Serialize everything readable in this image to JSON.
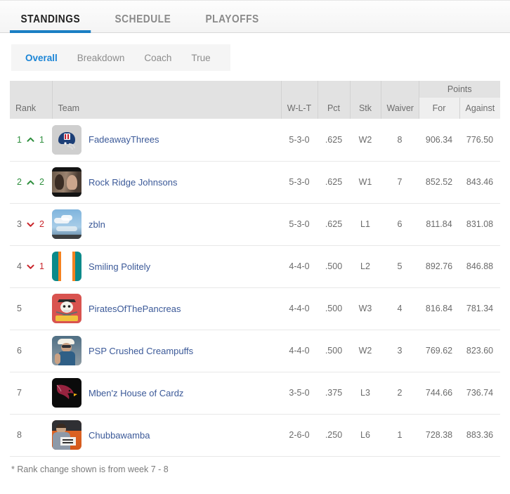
{
  "tabs": [
    {
      "label": "STANDINGS",
      "active": true
    },
    {
      "label": "SCHEDULE",
      "active": false
    },
    {
      "label": "PLAYOFFS",
      "active": false
    }
  ],
  "subtabs": [
    {
      "label": "Overall",
      "active": true
    },
    {
      "label": "Breakdown",
      "active": false
    },
    {
      "label": "Coach",
      "active": false
    },
    {
      "label": "True",
      "active": false
    }
  ],
  "table": {
    "group_header": "Points",
    "columns": {
      "rank": "Rank",
      "team": "Team",
      "wlt": "W-L-T",
      "pct": "Pct",
      "stk": "Stk",
      "waiver": "Waiver",
      "points_for": "For",
      "points_against": "Against"
    },
    "rows": [
      {
        "rank": "1",
        "change_dir": "up",
        "change": "1",
        "team": "FadeawayThrees",
        "avatar": "helmet",
        "wlt": "5-3-0",
        "pct": ".625",
        "stk": "W2",
        "waiver": "8",
        "pf": "906.34",
        "pa": "776.50"
      },
      {
        "rank": "2",
        "change_dir": "up",
        "change": "2",
        "team": "Rock Ridge Johnsons",
        "avatar": "photo1",
        "wlt": "5-3-0",
        "pct": ".625",
        "stk": "W1",
        "waiver": "7",
        "pf": "852.52",
        "pa": "843.46"
      },
      {
        "rank": "3",
        "change_dir": "down",
        "change": "2",
        "team": "zbln",
        "avatar": "sky",
        "wlt": "5-3-0",
        "pct": ".625",
        "stk": "L1",
        "waiver": "6",
        "pf": "811.84",
        "pa": "831.08"
      },
      {
        "rank": "4",
        "change_dir": "down",
        "change": "1",
        "team": "Smiling Politely",
        "avatar": "stripes",
        "wlt": "4-4-0",
        "pct": ".500",
        "stk": "L2",
        "waiver": "5",
        "pf": "892.76",
        "pa": "846.88"
      },
      {
        "rank": "5",
        "change_dir": "none",
        "change": "",
        "team": "PiratesOfThePancreas",
        "avatar": "pirate",
        "wlt": "4-4-0",
        "pct": ".500",
        "stk": "W3",
        "waiver": "4",
        "pf": "816.84",
        "pa": "781.34"
      },
      {
        "rank": "6",
        "change_dir": "none",
        "change": "",
        "team": "PSP Crushed Creampuffs",
        "avatar": "beach",
        "wlt": "4-4-0",
        "pct": ".500",
        "stk": "W2",
        "waiver": "3",
        "pf": "769.62",
        "pa": "823.60"
      },
      {
        "rank": "7",
        "change_dir": "none",
        "change": "",
        "team": "Mben'z House of Cardz",
        "avatar": "cardinal",
        "wlt": "3-5-0",
        "pct": ".375",
        "stk": "L3",
        "waiver": "2",
        "pf": "744.66",
        "pa": "736.74"
      },
      {
        "rank": "8",
        "change_dir": "none",
        "change": "",
        "team": "Chubbawamba",
        "avatar": "desk",
        "wlt": "2-6-0",
        "pct": ".250",
        "stk": "L6",
        "waiver": "1",
        "pf": "728.38",
        "pa": "883.36"
      }
    ]
  },
  "footnote": "* Rank change shown is from week 7 - 8",
  "colors": {
    "accent_blue": "#1b7fc4",
    "link_blue": "#3b5998",
    "up_green": "#2f8f3e",
    "down_red": "#c9252b",
    "header_gray": "#e2e2e2"
  }
}
